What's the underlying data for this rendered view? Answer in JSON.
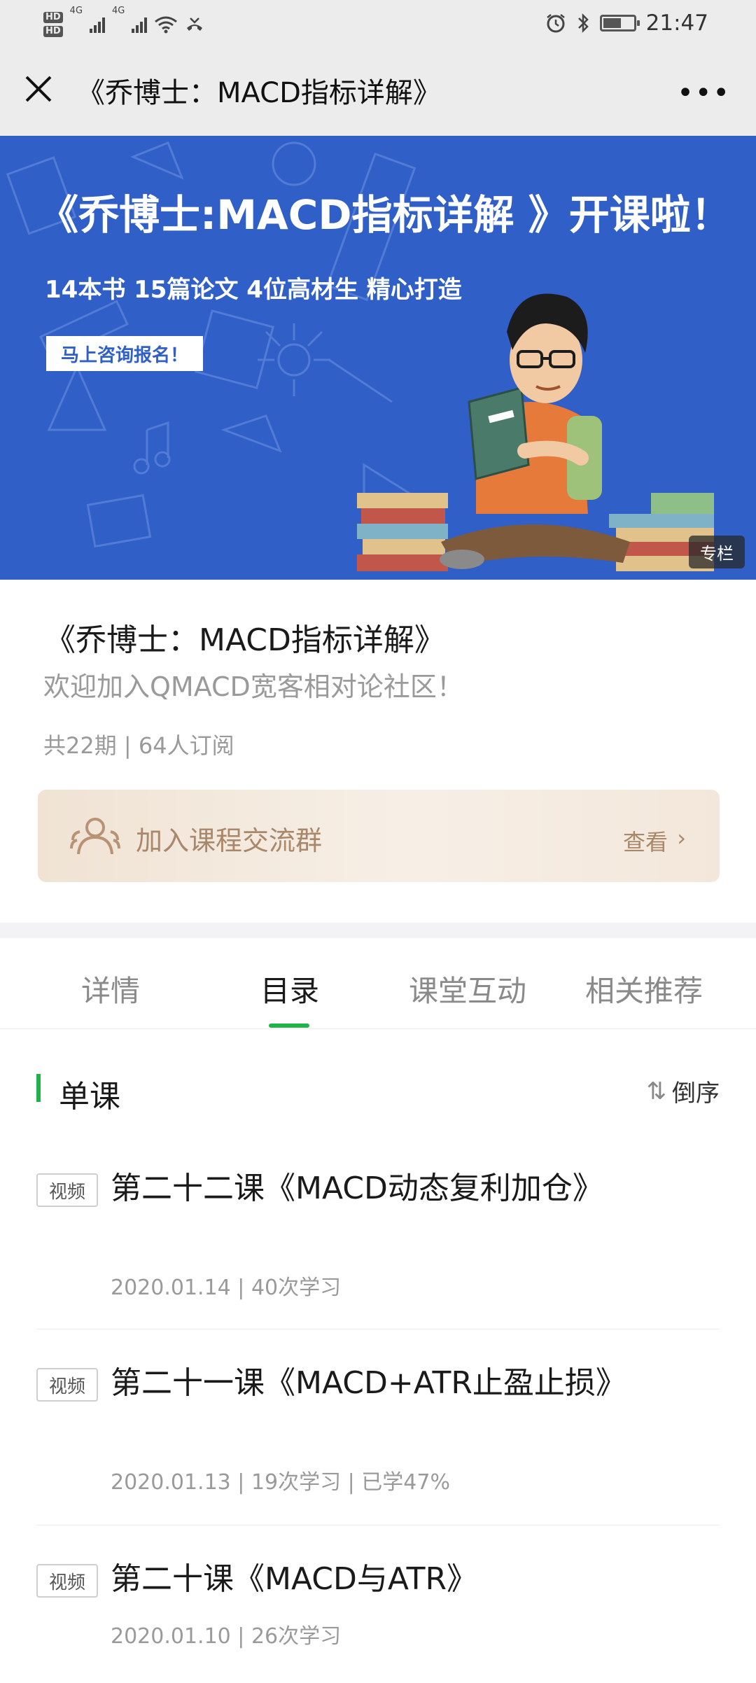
{
  "status_bar": {
    "network_labels": [
      "HD",
      "HD",
      "4G",
      "4G"
    ],
    "time": "21:47",
    "icons": [
      "alarm-icon",
      "bluetooth-icon",
      "battery-icon",
      "wifi-icon",
      "signal-icon"
    ]
  },
  "nav": {
    "title": "《乔博士：MACD指标详解》",
    "close_icon": "close-icon",
    "more_icon": "more-icon"
  },
  "banner": {
    "headline": "《乔博士:MACD指标详解 》开课啦！",
    "subline": "14本书 15篇论文 4位高材生 精心打造",
    "cta": "马上咨询报名！",
    "tag": "专栏",
    "background_color": "#2f5fc7"
  },
  "course": {
    "title": "《乔博士：MACD指标详解》",
    "description": "欢迎加入QMACD宽客相对论社区！",
    "meta": "共22期 | 64人订阅"
  },
  "group_card": {
    "label": "加入课程交流群",
    "action": "查看",
    "icon": "people-icon"
  },
  "tabs": [
    {
      "label": "详情",
      "active": false
    },
    {
      "label": "目录",
      "active": true
    },
    {
      "label": "课堂互动",
      "active": false
    },
    {
      "label": "相关推荐",
      "active": false
    }
  ],
  "section": {
    "title": "单课",
    "sort_label": "倒序",
    "sort_icon": "sort-icon",
    "accent_color": "#21b24b"
  },
  "lessons": [
    {
      "badge": "视频",
      "title": "第二十二课《MACD动态复利加仓》",
      "meta": "2020.01.14 | 40次学习"
    },
    {
      "badge": "视频",
      "title": "第二十一课《MACD+ATR止盈止损》",
      "meta": "2020.01.13 | 19次学习 | 已学47%"
    },
    {
      "badge": "视频",
      "title": "第二十课《MACD与ATR》",
      "meta": "2020.01.10 | 26次学习"
    }
  ]
}
